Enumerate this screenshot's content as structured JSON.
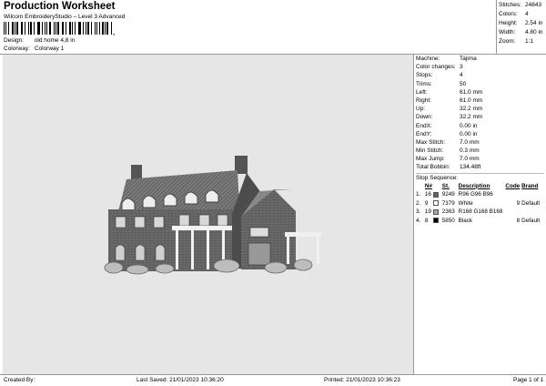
{
  "header": {
    "title": "Production Worksheet",
    "software": "Wilcom EmbroideryStudio – Level 3 Advanced",
    "barcode_mark": ",",
    "design_label": "Design:",
    "design_value": "old home 4,8 in",
    "colorway_label": "Colorway:",
    "colorway_value": "Colorway 1"
  },
  "stats": [
    {
      "label": "Stitches:",
      "value": "24843"
    },
    {
      "label": "Colors:",
      "value": "4"
    },
    {
      "label": "Height:",
      "value": "2.54 in"
    },
    {
      "label": "Width:",
      "value": "4.80 in"
    },
    {
      "label": "Zoom:",
      "value": "1:1"
    }
  ],
  "machine_info": [
    {
      "label": "Machine:",
      "value": "Tajima"
    },
    {
      "label": "Color changes:",
      "value": "3"
    },
    {
      "label": "Stops:",
      "value": "4"
    },
    {
      "label": "Trims:",
      "value": "50"
    },
    {
      "label": "Left:",
      "value": "61.0 mm"
    },
    {
      "label": "Right:",
      "value": "61.0 mm"
    },
    {
      "label": "Up:",
      "value": "32.2 mm"
    },
    {
      "label": "Down:",
      "value": "32.2 mm"
    },
    {
      "label": "EndX:",
      "value": "0.00 in"
    },
    {
      "label": "EndY:",
      "value": "0.00 in"
    },
    {
      "label": "Max Stitch:",
      "value": "7.0 mm"
    },
    {
      "label": "Min Stitch:",
      "value": "0.3 mm"
    },
    {
      "label": "Max Jump:",
      "value": "7.0 mm"
    },
    {
      "label": "Total Bobbin:",
      "value": "134.48ft"
    }
  ],
  "stop_sequence": {
    "title": "Stop Sequence:",
    "headers": {
      "num": "N#",
      "st": "St.",
      "description": "Description",
      "code": "Code",
      "brand": "Brand"
    },
    "rows": [
      {
        "index": "1.",
        "num": "16",
        "color": "#606060",
        "st": "9249",
        "description": "R96 G96 B96",
        "code": "",
        "brand": ""
      },
      {
        "index": "2.",
        "num": "9",
        "color": "#ffffff",
        "st": "7379",
        "description": "White",
        "code": "9",
        "brand": "Default"
      },
      {
        "index": "3.",
        "num": "19",
        "color": "#a8a8a8",
        "st": "2363",
        "description": "R168 G168 B168",
        "code": "",
        "brand": ""
      },
      {
        "index": "4.",
        "num": "8",
        "color": "#000000",
        "st": "5850",
        "description": "Black",
        "code": "8",
        "brand": "Default"
      }
    ]
  },
  "footer": {
    "created_by": "Created By:",
    "last_saved": "Last Saved: 21/01/2023 10:36:20",
    "printed": "Printed: 21/01/2023 10:36:23",
    "page": "Page 1 of 1"
  }
}
